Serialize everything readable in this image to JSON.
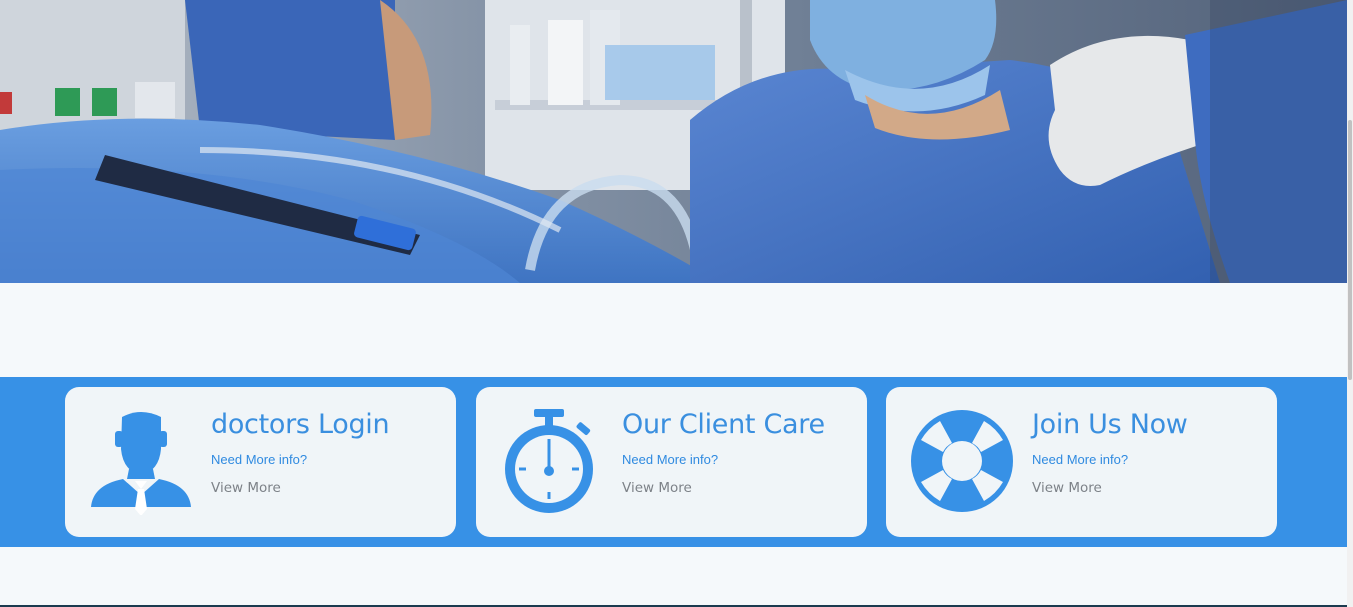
{
  "hero": {
    "icon": "surgery-photo"
  },
  "features": {
    "cards": [
      {
        "icon": "doctor-icon",
        "title": "doctors Login",
        "info": "Need More info?",
        "more": "View More"
      },
      {
        "icon": "stopwatch-icon",
        "title": "Our Client Care",
        "info": "Need More info?",
        "more": "View More"
      },
      {
        "icon": "lifebuoy-icon",
        "title": "Join Us Now",
        "info": "Need More info?",
        "more": "View More"
      }
    ]
  },
  "colors": {
    "accent": "#3791e6",
    "card_bg": "#f0f5f8",
    "page_bg": "#f5f9fb",
    "link_text": "#7d8288"
  }
}
